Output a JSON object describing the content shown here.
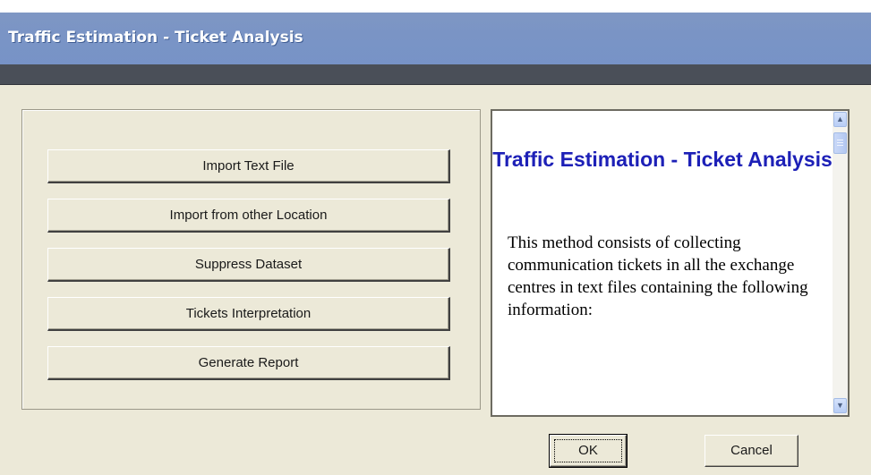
{
  "window": {
    "title": "Traffic Estimation - Ticket Analysis"
  },
  "actions": {
    "buttons": [
      {
        "label": "Import Text File"
      },
      {
        "label": "Import from other Location"
      },
      {
        "label": "Suppress Dataset"
      },
      {
        "label": "Tickets Interpretation"
      },
      {
        "label": "Generate Report"
      }
    ]
  },
  "info": {
    "heading": "Traffic Estimation - Ticket Analysis",
    "body": "This method consists of collecting communication tickets in all the exchange centres in text files containing the following information:"
  },
  "dialog": {
    "ok_label": "OK",
    "cancel_label": "Cancel"
  },
  "icons": {
    "scroll_up": "chevron-up-icon",
    "scroll_down": "chevron-down-icon"
  },
  "colors": {
    "heading": "#1d20b7",
    "titlebar": "#7a94c5",
    "face": "#ece9d8"
  }
}
